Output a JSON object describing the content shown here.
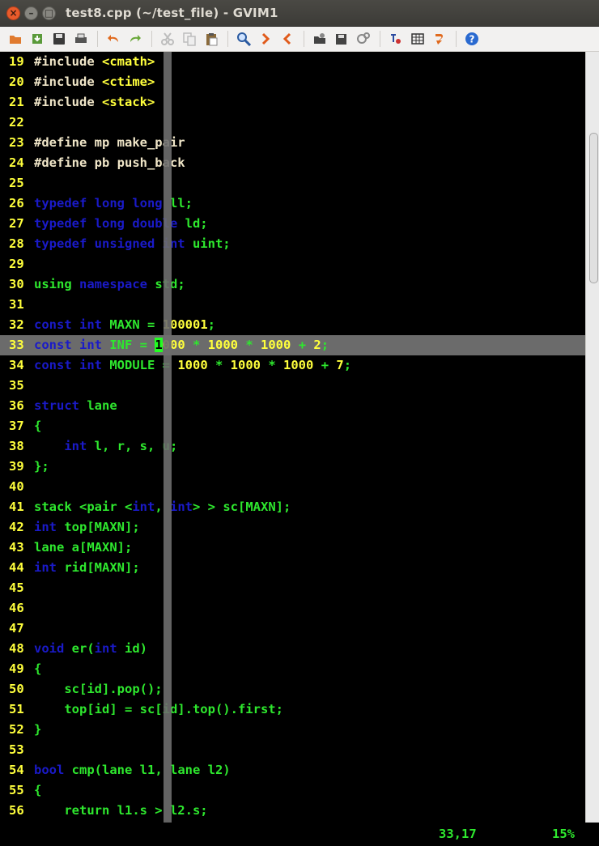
{
  "window": {
    "title": "test8.cpp (~/test_file) - GVIM1"
  },
  "toolbar": {
    "buttons": [
      {
        "name": "open-icon",
        "color": "#e07a2e"
      },
      {
        "name": "save-download-icon",
        "color": "#5a9a3a"
      },
      {
        "name": "save-icon",
        "color": "#3a3a3a"
      },
      {
        "name": "print-icon",
        "color": "#555555"
      },
      {
        "name": "undo-icon",
        "color": "#e06a1e"
      },
      {
        "name": "redo-icon",
        "color": "#6aa83a"
      },
      {
        "name": "cut-icon",
        "color": "#bdbdbd"
      },
      {
        "name": "copy-icon",
        "color": "#bdbdbd"
      },
      {
        "name": "paste-icon",
        "color": "#8a6a3a"
      },
      {
        "name": "find-replace-icon",
        "color": "#2a5aa0"
      },
      {
        "name": "find-next-icon",
        "color": "#e05a1a"
      },
      {
        "name": "find-prev-icon",
        "color": "#e05a1a"
      },
      {
        "name": "load-session-icon",
        "color": "#444444"
      },
      {
        "name": "save-session-icon",
        "color": "#444444"
      },
      {
        "name": "run-script-icon",
        "color": "#888888"
      },
      {
        "name": "make-icon",
        "color": "#cc3333"
      },
      {
        "name": "build-tags-icon",
        "color": "#333333"
      },
      {
        "name": "jump-tag-icon",
        "color": "#e06a1e"
      },
      {
        "name": "help-icon",
        "color": "#2a6ad0"
      }
    ]
  },
  "colors": {
    "keyword": "#1a1ac8",
    "text": "#2ee82e",
    "number": "#ffff3c",
    "preproc": "#f0e6c8",
    "line_number": "#ffff3c",
    "cursor_line": "#6b6b6b",
    "cursor": "#22ff22"
  },
  "editor": {
    "current_line": 33,
    "lines": [
      {
        "n": "19",
        "t": [
          [
            "pre",
            "#include "
          ],
          [
            "yellow",
            "<cmath>"
          ]
        ]
      },
      {
        "n": "20",
        "t": [
          [
            "pre",
            "#include "
          ],
          [
            "yellow",
            "<ctime>"
          ]
        ]
      },
      {
        "n": "21",
        "t": [
          [
            "pre",
            "#include "
          ],
          [
            "yellow",
            "<stack>"
          ]
        ]
      },
      {
        "n": "22",
        "t": []
      },
      {
        "n": "23",
        "t": [
          [
            "pre",
            "#define mp make_pair"
          ]
        ]
      },
      {
        "n": "24",
        "t": [
          [
            "pre",
            "#define pb push_back"
          ]
        ]
      },
      {
        "n": "25",
        "t": []
      },
      {
        "n": "26",
        "t": [
          [
            "blue",
            "typedef long long "
          ],
          [
            "green",
            "ll;"
          ]
        ]
      },
      {
        "n": "27",
        "t": [
          [
            "blue",
            "typedef long double "
          ],
          [
            "green",
            "ld;"
          ]
        ]
      },
      {
        "n": "28",
        "t": [
          [
            "blue",
            "typedef unsigned int "
          ],
          [
            "green",
            "uint;"
          ]
        ]
      },
      {
        "n": "29",
        "t": []
      },
      {
        "n": "30",
        "t": [
          [
            "green",
            "using "
          ],
          [
            "blue",
            "namespace "
          ],
          [
            "green",
            "std;"
          ]
        ]
      },
      {
        "n": "31",
        "t": []
      },
      {
        "n": "32",
        "t": [
          [
            "blue",
            "const int "
          ],
          [
            "green",
            "MAXN = "
          ],
          [
            "yellow",
            "100001"
          ],
          [
            "green",
            ";"
          ]
        ]
      },
      {
        "n": "33",
        "t": [
          [
            "blue",
            "const int "
          ],
          [
            "green",
            "INF = "
          ],
          [
            "cursor",
            "1"
          ],
          [
            "yellow",
            "000 "
          ],
          [
            "green",
            "* "
          ],
          [
            "yellow",
            "1000 "
          ],
          [
            "green",
            "* "
          ],
          [
            "yellow",
            "1000 "
          ],
          [
            "green",
            "+ "
          ],
          [
            "yellow",
            "2"
          ],
          [
            "green",
            ";"
          ]
        ]
      },
      {
        "n": "34",
        "t": [
          [
            "blue",
            "const int "
          ],
          [
            "green",
            "MODULE = "
          ],
          [
            "yellow",
            "1000 "
          ],
          [
            "green",
            "* "
          ],
          [
            "yellow",
            "1000 "
          ],
          [
            "green",
            "* "
          ],
          [
            "yellow",
            "1000 "
          ],
          [
            "green",
            "+ "
          ],
          [
            "yellow",
            "7"
          ],
          [
            "green",
            ";"
          ]
        ]
      },
      {
        "n": "35",
        "t": []
      },
      {
        "n": "36",
        "t": [
          [
            "blue",
            "struct "
          ],
          [
            "green",
            "lane"
          ]
        ]
      },
      {
        "n": "37",
        "t": [
          [
            "green",
            "{"
          ]
        ]
      },
      {
        "n": "38",
        "t": [
          [
            "green",
            "    "
          ],
          [
            "blue",
            "int "
          ],
          [
            "green",
            "l, r, s, u;"
          ]
        ]
      },
      {
        "n": "39",
        "t": [
          [
            "green",
            "};"
          ]
        ]
      },
      {
        "n": "40",
        "t": []
      },
      {
        "n": "41",
        "t": [
          [
            "green",
            "stack <pair <"
          ],
          [
            "blue",
            "int"
          ],
          [
            "green",
            ", "
          ],
          [
            "blue",
            "int"
          ],
          [
            "green",
            "> > sc[MAXN];"
          ]
        ]
      },
      {
        "n": "42",
        "t": [
          [
            "blue",
            "int "
          ],
          [
            "green",
            "top[MAXN];"
          ]
        ]
      },
      {
        "n": "43",
        "t": [
          [
            "green",
            "lane a[MAXN];"
          ]
        ]
      },
      {
        "n": "44",
        "t": [
          [
            "blue",
            "int "
          ],
          [
            "green",
            "rid[MAXN];"
          ]
        ]
      },
      {
        "n": "45",
        "t": []
      },
      {
        "n": "46",
        "t": []
      },
      {
        "n": "47",
        "t": []
      },
      {
        "n": "48",
        "t": [
          [
            "blue",
            "void "
          ],
          [
            "green",
            "er("
          ],
          [
            "blue",
            "int "
          ],
          [
            "green",
            "id)"
          ]
        ]
      },
      {
        "n": "49",
        "t": [
          [
            "green",
            "{"
          ]
        ]
      },
      {
        "n": "50",
        "t": [
          [
            "green",
            "    sc[id].pop();"
          ]
        ]
      },
      {
        "n": "51",
        "t": [
          [
            "green",
            "    top[id] = sc[id].top().first;"
          ]
        ]
      },
      {
        "n": "52",
        "t": [
          [
            "green",
            "}"
          ]
        ]
      },
      {
        "n": "53",
        "t": []
      },
      {
        "n": "54",
        "t": [
          [
            "blue",
            "bool "
          ],
          [
            "green",
            "cmp(lane l1, lane l2)"
          ]
        ]
      },
      {
        "n": "55",
        "t": [
          [
            "green",
            "{"
          ]
        ]
      },
      {
        "n": "56",
        "t": [
          [
            "green",
            "    return l1.s > l2.s;"
          ]
        ]
      }
    ]
  },
  "status": {
    "position": "33,17",
    "percent": "15%"
  }
}
